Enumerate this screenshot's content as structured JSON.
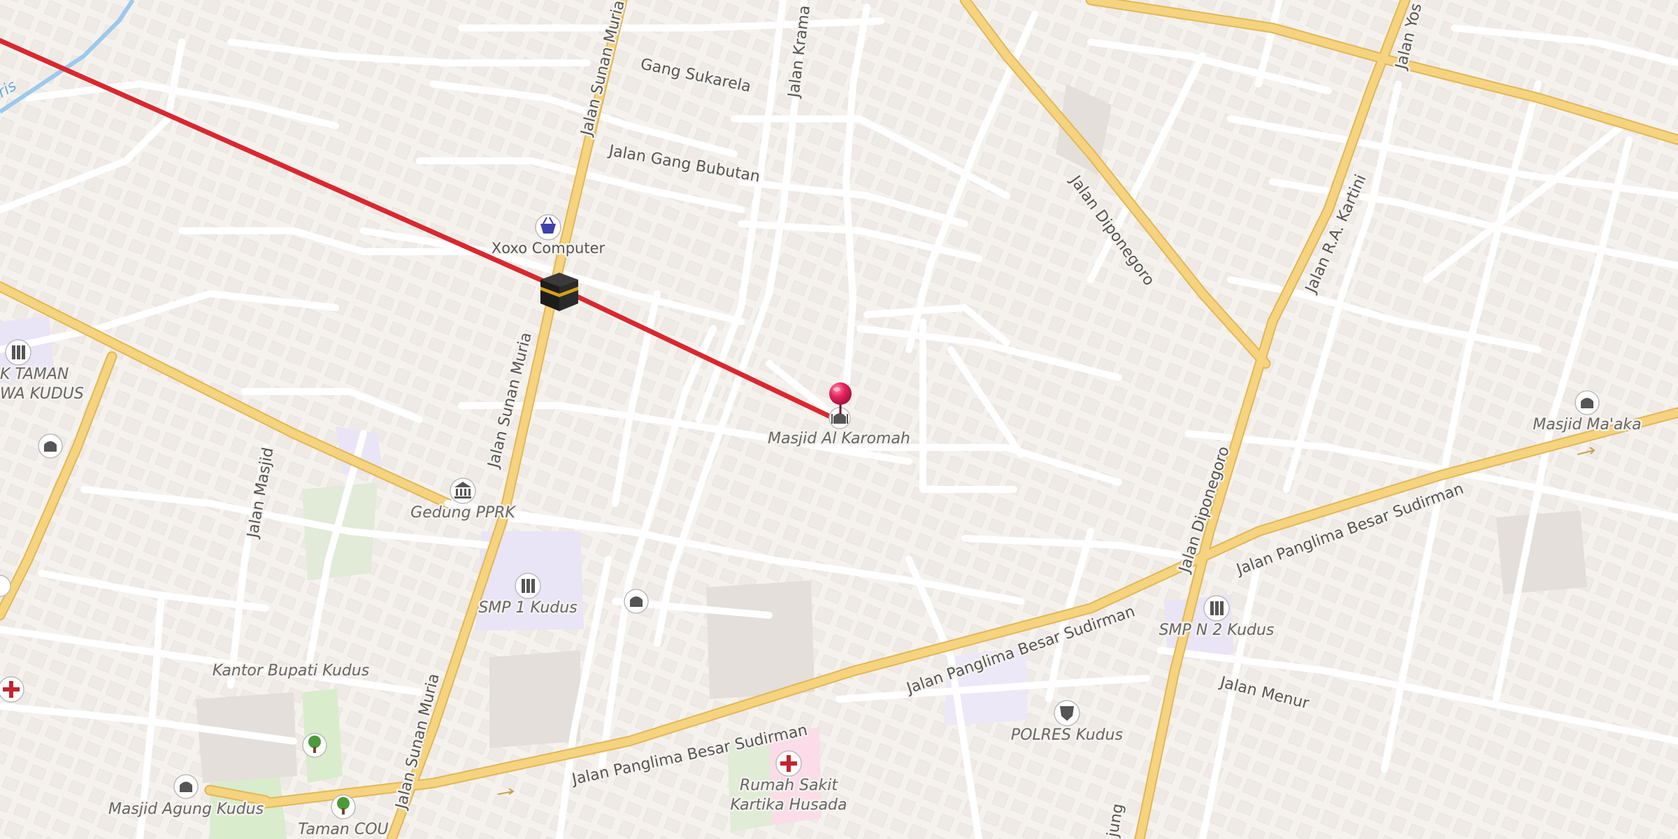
{
  "map": {
    "colors": {
      "background": "#f5f2ee",
      "minor_road": "#ffffff",
      "major_road": "#f6d37f",
      "major_road_casing": "#e0b858",
      "building": "#e6e1dc",
      "school_area": "#e9e4f6",
      "park_area": "#d9eccc",
      "hospital_area": "#fbdce8",
      "water": "#9cc9ee",
      "route": "#d9282f",
      "pin": "#e5245e"
    },
    "streets": {
      "sunan_muria_a": "Jalan Sunan Muria",
      "sunan_muria_b": "Jalan Sunan Muria",
      "sunan_muria_c": "Jalan Sunan Muria",
      "gang_sukarela": "Gang Sukarela",
      "gang_bubutan": "Jalan Gang Bubutan",
      "krama": "Jalan Krama",
      "diponegoro_a": "Jalan Diponegoro",
      "diponegoro_b": "Jalan Diponegoro",
      "ra_kartini": "Jalan R.A. Kartini",
      "yos": "Jalan Yos",
      "masjid": "Jalan Masjid",
      "sudirman_a": "Jalan Panglima Besar Sudirman",
      "sudirman_b": "Jalan Panglima Besar Sudirman",
      "sudirman_c": "Jalan Panglima Besar Sudirman",
      "menur": "Jalan Menur",
      "jung": "jung",
      "river": "ris"
    },
    "pois": {
      "xoxo_computer": "Xoxo Computer",
      "masjid_al_karomah": "Masjid Al Karomah",
      "gedung_pprk": "Gedung PPRK",
      "smp1": "SMP 1 Kudus",
      "kantor_bupati": "Kantor Bupati Kudus",
      "masjid_agung": "Masjid Agung Kudus",
      "taman_cou": "Taman COU",
      "rumah_sakit_1": "Rumah Sakit",
      "rumah_sakit_2": "Kartika Husada",
      "polres": "POLRES Kudus",
      "smpn2": "SMP N 2 Kudus",
      "masjid_maaka": "Masjid Ma'aka",
      "taman_siswa_1": "K TAMAN",
      "taman_siswa_2": "WA KUDUS"
    },
    "icons": {
      "shop": "shopping-basket-icon",
      "kaaba": "kaaba-icon",
      "pin": "location-pin-icon",
      "mosque": "mosque-icon",
      "school": "school-icon",
      "government": "government-building-icon",
      "hospital": "hospital-cross-icon",
      "police": "police-icon",
      "park": "tree-icon"
    }
  }
}
